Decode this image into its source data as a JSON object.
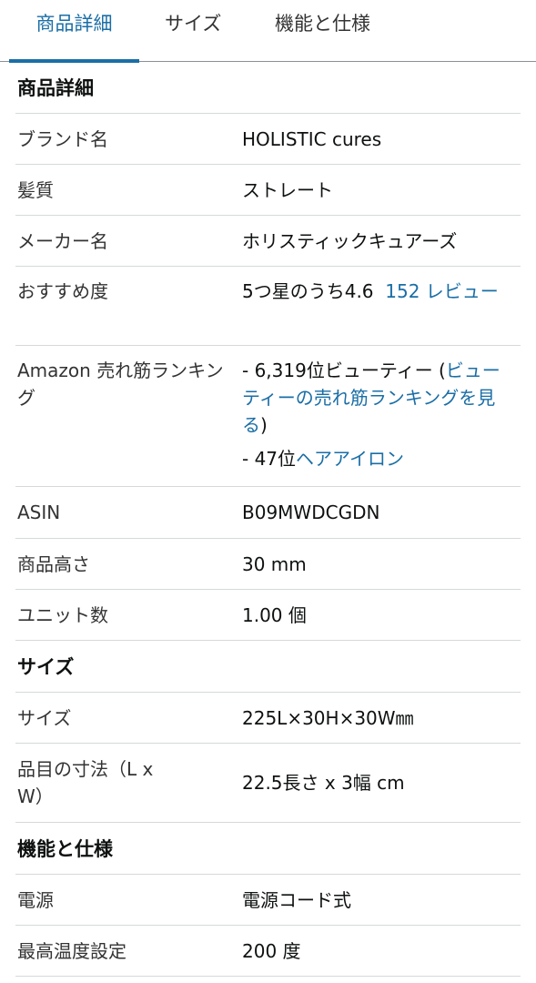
{
  "tabs": [
    {
      "label": "商品詳細",
      "active": true
    },
    {
      "label": "サイズ",
      "active": false
    },
    {
      "label": "機能と仕様",
      "active": false
    }
  ],
  "colors": {
    "accent": "#1a6ea6",
    "divider": "#d5d9d9",
    "text": "#0f1111"
  },
  "sections": {
    "details": {
      "title": "商品詳細",
      "brand": {
        "label": "ブランド名",
        "value": "HOLISTIC cures"
      },
      "hair": {
        "label": "髪質",
        "value": "ストレート"
      },
      "maker": {
        "label": "メーカー名",
        "value": "ホリスティックキュアーズ"
      },
      "rating": {
        "label": "おすすめ度",
        "value": "5つ星のうち4.6",
        "link": "152 レビュー"
      },
      "ranking": {
        "label": "Amazon 売れ筋ランキング",
        "line1_prefix": "- 6,319位ビューティー (",
        "line1_link": "ビューティーの売れ筋ランキングを見る",
        "line1_suffix": ")",
        "line2_prefix": "- 47位",
        "line2_link": "ヘアアイロン"
      },
      "asin": {
        "label": "ASIN",
        "value": "B09MWDCGDN"
      },
      "height": {
        "label": "商品高さ",
        "value": "30 mm"
      },
      "units": {
        "label": "ユニット数",
        "value": "1.00 個"
      }
    },
    "size": {
      "title": "サイズ",
      "size": {
        "label": "サイズ",
        "value": "225L×30H×30W㎜"
      },
      "dimensions": {
        "label": "品目の寸法（L x W）",
        "value": "22.5長さ x 3幅 cm"
      }
    },
    "features": {
      "title": "機能と仕様",
      "power": {
        "label": "電源",
        "value": "電源コード式"
      },
      "maxtemp": {
        "label": "最高温度設定",
        "value": "200 度"
      }
    }
  }
}
